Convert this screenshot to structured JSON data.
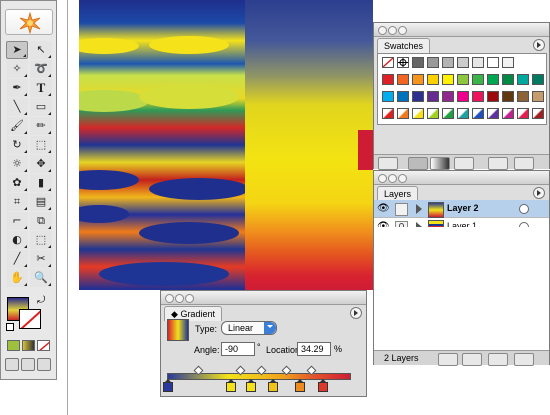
{
  "tools": {
    "items": [
      "selection",
      "direct-selection",
      "magic-wand",
      "lasso",
      "pen",
      "type",
      "line-segment",
      "rectangle",
      "paintbrush",
      "pencil",
      "rotate",
      "scale",
      "warp",
      "free-transform",
      "symbol-sprayer",
      "column-graph",
      "mesh",
      "gradient",
      "eyedropper",
      "blend",
      "live-paint-bucket",
      "live-paint-selection",
      "slice",
      "scissors",
      "hand",
      "zoom"
    ],
    "selected_index": 0
  },
  "swatches": {
    "title": "Swatches",
    "colors": [
      [
        "#000000",
        "#333333",
        "#666666",
        "#999999",
        "#b3b3b3",
        "#cccccc",
        "#e6e6e6",
        "#ffffff",
        "#f2f2f2"
      ],
      [
        "#e01f26",
        "#f26522",
        "#f7941d",
        "#fbd000",
        "#fff200",
        "#8dc63f",
        "#39b54a",
        "#00a651",
        "#008a45",
        "#00a99d",
        "#007a60"
      ],
      [
        "#00aeef",
        "#0072bc",
        "#2e3192",
        "#662d91",
        "#92278f",
        "#ec008c",
        "#ed145b",
        "#9e0b0f",
        "#603913",
        "#8c6239",
        "#c69c6d"
      ],
      [
        "gradient",
        "gradient",
        "gradient",
        "gradient",
        "gradient",
        "gradient",
        "gradient",
        "gradient",
        "gradient",
        "gradient",
        "gradient"
      ]
    ]
  },
  "layers": {
    "title": "Layers",
    "items": [
      {
        "name": "Layer 2",
        "active": true,
        "color": "#3d6fe0"
      },
      {
        "name": "Layer 1",
        "active": false,
        "color": "#e03d3d"
      }
    ],
    "count_label": "2 Layers"
  },
  "gradient": {
    "title": "Gradient",
    "type_label": "Type:",
    "type_value": "Linear",
    "angle_label": "Angle:",
    "angle_value": "-90",
    "degree_symbol": "°",
    "location_label": "Location:",
    "location_value": "34.29",
    "percent_symbol": "%",
    "stops": [
      {
        "position": 0.0,
        "color": "#2a3a9a"
      },
      {
        "position": 0.34,
        "color": "#f3e21a"
      },
      {
        "position": 0.45,
        "color": "#f5e01a"
      },
      {
        "position": 0.57,
        "color": "#f0c21a"
      },
      {
        "position": 0.72,
        "color": "#ef8a1e"
      },
      {
        "position": 0.84,
        "color": "#de3a2a"
      }
    ]
  }
}
